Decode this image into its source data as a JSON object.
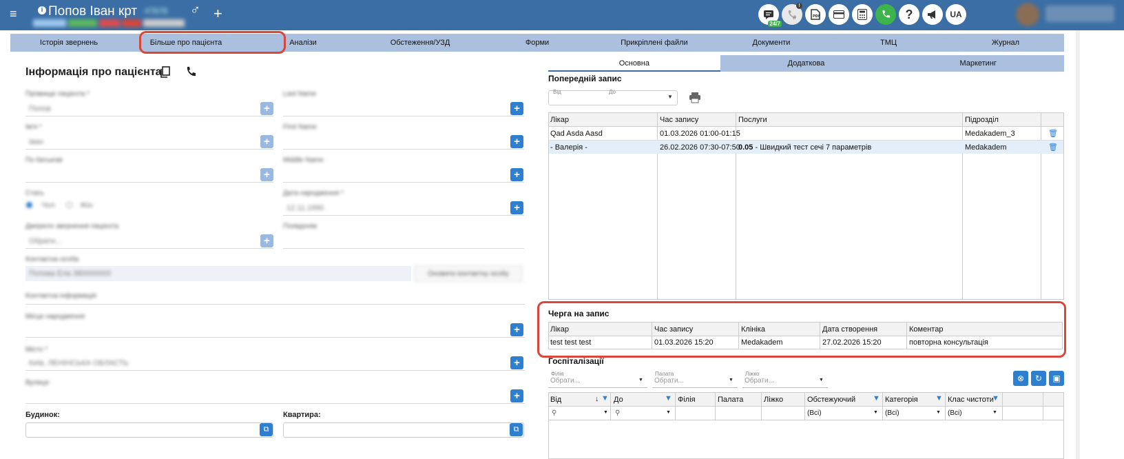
{
  "header": {
    "patient_name": "Попов Іван крт",
    "patient_id": "#7676",
    "gender_symbol": "♂",
    "add_symbol": "+",
    "menu_symbol": "≡",
    "chat_badge": "24/7",
    "notif_badge": "!",
    "help_label": "?",
    "lang_label": "UA",
    "tags": [
      "#a0c8f0",
      "#5cb85c",
      "#e04b4b",
      "#d9463a",
      "#cccccc"
    ]
  },
  "tabs": [
    "Історія звернень",
    "Більше про пацієнта",
    "Аналізи",
    "Обстеження/УЗД",
    "Форми",
    "Прикріплені файли",
    "Документи",
    "ТМЦ",
    "Журнал"
  ],
  "left": {
    "title": "Інформація про пацієнта",
    "blurred_labels": [
      "Прізвище пацієнта *",
      "Ім'я *",
      "По батькові",
      "Стать",
      "Джерело звернення пацієнта",
      "Контактна особа",
      "Контактна інформація",
      "Місце народження",
      "Місто *",
      "Вулиця"
    ],
    "blurred_right_labels": [
      "Last Name",
      "First Name",
      "Middle Name",
      "Дата народження *",
      "Псевдонім"
    ],
    "blurred_values": [
      "Попов",
      "Іван",
      "Чол",
      "Жін",
      "Обрати...",
      "Попова Ела 380000000",
      "Київ, ЛЕНІНСЬКА ОБЛАСТЬ",
      "12.11.1990"
    ],
    "contact_button": "Оновити контактну особу",
    "building_label": "Будинок:",
    "apartment_label": "Квартира:"
  },
  "right": {
    "subtabs": [
      "Основна",
      "Додаткова",
      "Маркетинг"
    ],
    "previous_title": "Попередній запис",
    "from_label": "Від",
    "to_label": "До",
    "appointments": {
      "columns": [
        "Лікар",
        "Час запису",
        "Послуги",
        "Підрозділ"
      ],
      "rows": [
        {
          "doctor": "Qad Asda Aasd",
          "time": "01.03.2026 01:00-01:15",
          "code": "",
          "service": "",
          "unit": "Medakadem_3"
        },
        {
          "doctor": "- Валерія -",
          "time": "26.02.2026 07:30-07:50",
          "code": "0.05",
          "service": " - Швидкий тест сечі 7 параметрів",
          "unit": "Medakadem"
        }
      ]
    },
    "queue_title": "Черга на запис",
    "queue": {
      "columns": [
        "Лікар",
        "Час запису",
        "Клініка",
        "Дата створення",
        "Коментар"
      ],
      "rows": [
        {
          "doctor": "test test test",
          "time": "01.03.2026 15:20",
          "clinic": "Medakadem",
          "created": "27.02.2026 15:20",
          "comment": "повторна консультація"
        }
      ]
    },
    "hosp_title": "Госпіталізації",
    "hosp_filters": [
      {
        "label": "Філія",
        "placeholder": "Обрати..."
      },
      {
        "label": "Палата",
        "placeholder": "Обрати..."
      },
      {
        "label": "Ліжко",
        "placeholder": "Обрати..."
      }
    ],
    "hosp_columns": [
      "Від",
      "До",
      "Філія",
      "Палата",
      "Ліжко",
      "Обстежуючий",
      "Категорія",
      "Клас чистоти"
    ],
    "hosp_filter_values": [
      "(Всі)",
      "(Всі)",
      "(Всі)"
    ]
  },
  "colors": {
    "topbar": "#3a6ea5",
    "tabs": "#aac0de",
    "accent": "#2f7fd0",
    "highlight": "#d9463a"
  }
}
